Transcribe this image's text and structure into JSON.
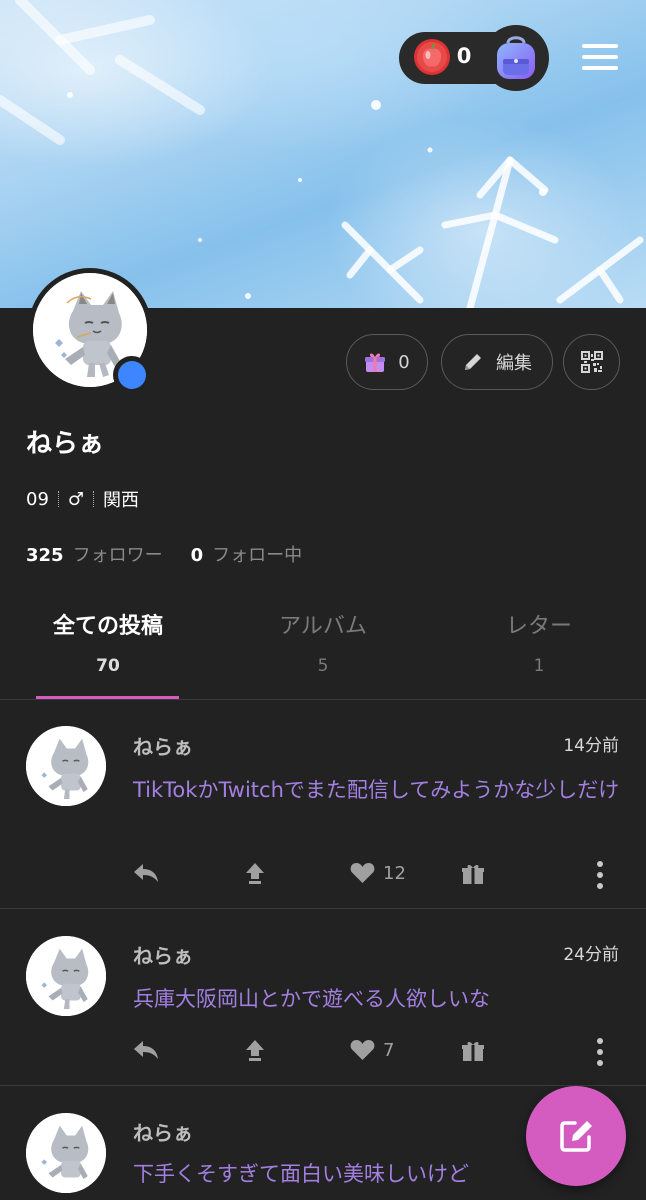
{
  "header": {
    "points": "0"
  },
  "profile": {
    "name": "ねらぁ",
    "age": "09",
    "gender": "♂",
    "region": "関西",
    "followers_count": "325",
    "followers_label": "フォロワー",
    "following_count": "0",
    "following_label": "フォロー中",
    "gift_count": "0",
    "edit_label": "編集",
    "online_color": "#3e86ff"
  },
  "tabs": [
    {
      "label": "全ての投稿",
      "count": "70"
    },
    {
      "label": "アルバム",
      "count": "5"
    },
    {
      "label": "レター",
      "count": "1"
    }
  ],
  "posts": [
    {
      "name": "ねらぁ",
      "time": "14分前",
      "text": "TikTokかTwitchでまた配信してみようかな少しだけ",
      "likes": "12"
    },
    {
      "name": "ねらぁ",
      "time": "24分前",
      "text": "兵庫大阪岡山とかで遊べる人欲しいな",
      "likes": "7"
    },
    {
      "name": "ねらぁ",
      "time": "",
      "text": "下手くそすぎて面白い美味しいけど",
      "likes": ""
    }
  ],
  "colors": {
    "accent": "#d45bbf",
    "post_text": "#a27fe0",
    "background": "#222222"
  },
  "icons": [
    "apple-icon",
    "backpack-icon",
    "hamburger-menu-icon",
    "gift-icon",
    "pencil-icon",
    "qr-code-icon",
    "reply-icon",
    "share-icon",
    "heart-icon",
    "gift-icon",
    "more-vertical-icon",
    "compose-icon"
  ]
}
